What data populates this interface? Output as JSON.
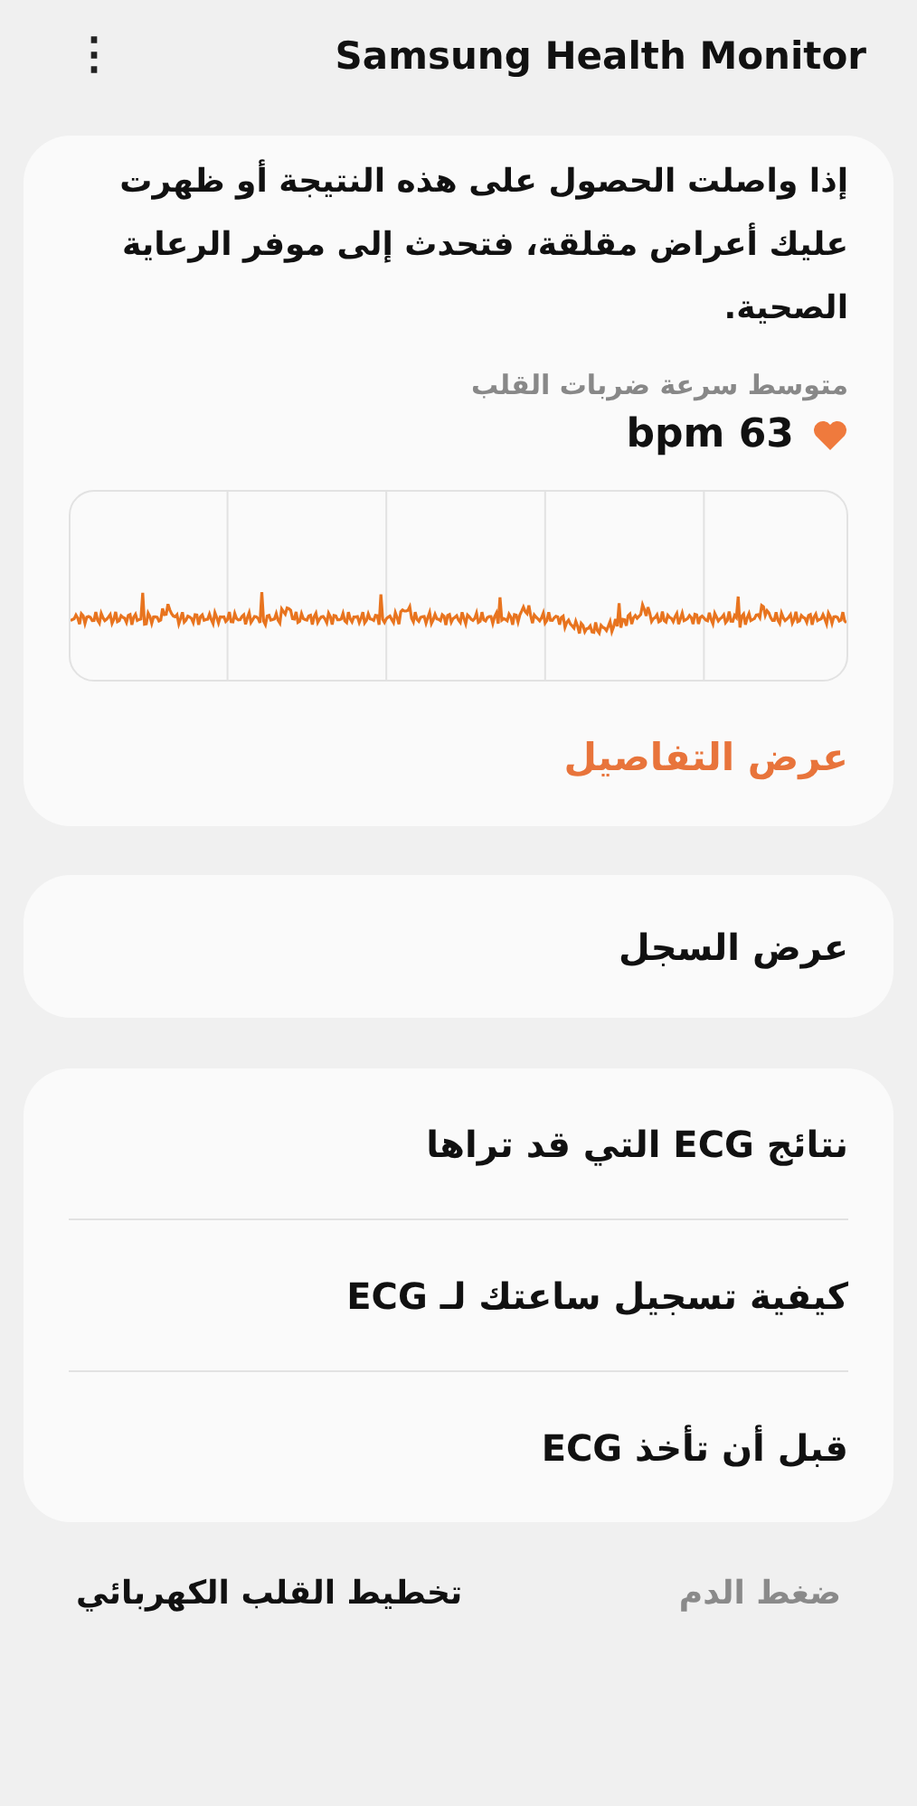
{
  "header": {
    "title": "Samsung Health Monitor",
    "menu_icon": "⋮"
  },
  "result_card": {
    "message": "إذا واصلت الحصول على هذه النتيجة أو ظهرت عليك أعراض مقلقة، فتحدث إلى موفر الرعاية الصحية.",
    "heart_rate_label": "متوسط سرعة ضربات القلب",
    "heart_rate_value": "bpm 63",
    "details_link": "عرض التفاصيل"
  },
  "history_card": {
    "label": "عرض السجل"
  },
  "info_list": [
    {
      "label": "نتائج ECG التي قد تراها"
    },
    {
      "label": "كيفية تسجيل ساعتك لـ ECG"
    },
    {
      "label": "قبل أن تأخذ ECG"
    }
  ],
  "bottom_tabs": [
    {
      "label": "ضغط الدم",
      "selected": false
    },
    {
      "label": "تخطيط القلب الكهربائي",
      "selected": true
    }
  ]
}
